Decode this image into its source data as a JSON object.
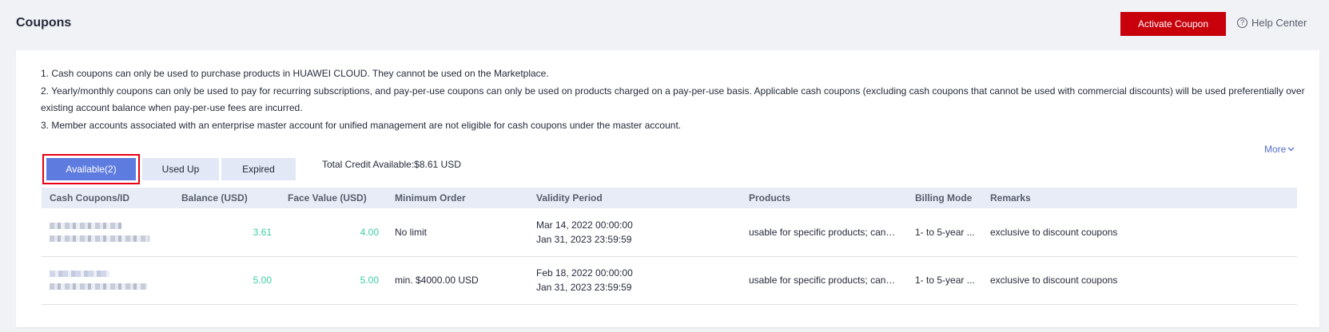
{
  "page": {
    "title": "Coupons"
  },
  "header": {
    "activate_label": "Activate Coupon",
    "help_label": "Help Center",
    "help_icon": "question-circle-icon"
  },
  "notes": [
    "1. Cash coupons can only be used to purchase products in HUAWEI CLOUD. They cannot be used on the Marketplace.",
    "2. Yearly/monthly coupons can only be used to pay for recurring subscriptions, and pay-per-use coupons can only be used on products charged on a pay-per-use basis. Applicable cash coupons (excluding cash coupons that cannot be used with commercial discounts) will be used preferentially over existing account balance when pay-per-use fees are incurred.",
    "3. Member accounts associated with an enterprise master account for unified management are not eligible for cash coupons under the master account."
  ],
  "more_label": "More",
  "tabs": [
    {
      "label": "Available(2)",
      "active": true
    },
    {
      "label": "Used Up",
      "active": false
    },
    {
      "label": "Expired",
      "active": false
    }
  ],
  "total_credit": "Total Credit Available:$8.61 USD",
  "table": {
    "columns": [
      "Cash Coupons/ID",
      "Balance (USD)",
      "Face Value (USD)",
      "Minimum Order",
      "Validity Period",
      "Products",
      "Billing Mode",
      "Remarks"
    ],
    "rows": [
      {
        "balance": "3.61",
        "face_value": "4.00",
        "minimum_order": "No limit",
        "validity_start": "Mar 14, 2022 00:00:00",
        "validity_end": "Jan 31, 2023 23:59:59",
        "products": "usable for specific products; canno...",
        "billing_mode": "1- to 5-year ...",
        "remarks": "exclusive to discount coupons"
      },
      {
        "balance": "5.00",
        "face_value": "5.00",
        "minimum_order": "min. $4000.00 USD",
        "validity_start": "Feb 18, 2022 00:00:00",
        "validity_end": "Jan 31, 2023 23:59:59",
        "products": "usable for specific products; canno...",
        "billing_mode": "1- to 5-year ...",
        "remarks": "exclusive to discount coupons"
      }
    ]
  },
  "colors": {
    "brand_red": "#c7000b",
    "active_tab": "#5e7ce0",
    "value_green": "#3dcca6",
    "link_blue": "#526ecc",
    "highlight_border": "#e60012"
  }
}
